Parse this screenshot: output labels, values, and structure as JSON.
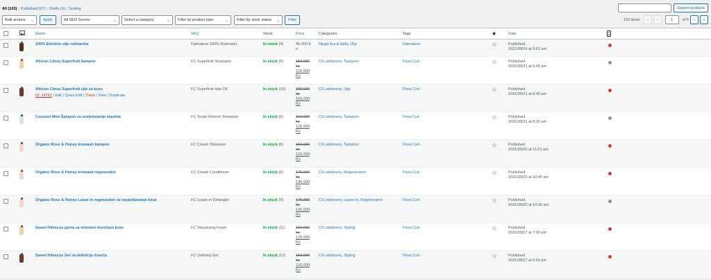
{
  "views": {
    "all": "All (103)",
    "published": "Published (97)",
    "drafts": "Drafts (6)",
    "sorting": "Sorting"
  },
  "search": {
    "button": "Search products"
  },
  "filters": {
    "bulk_actions": "Bulk actions",
    "apply": "Apply",
    "seo_scores": "All SEO Scores",
    "category": "Select a category",
    "product_type": "Filter by product type",
    "stock_status": "Filter by stock status",
    "filter": "Filter"
  },
  "pagination": {
    "items": "103 items",
    "first": "«",
    "prev": "‹",
    "page": "1",
    "of": "of 5",
    "next": "›",
    "last": "»"
  },
  "columns": {
    "name": "Name",
    "sku": "SKU",
    "stock": "Stock",
    "price": "Price",
    "categories": "Categories",
    "tags": "Tags",
    "date": "Date"
  },
  "row_actions": {
    "id": "ID: 14761",
    "edit": "Edit",
    "quick_edit": "Quick Edit",
    "trash": "Trash",
    "view": "View",
    "duplicate": "Duplicate"
  },
  "rows": [
    {
      "name": "100% Eterično ulje ružmarina",
      "sku": "Dalmature 100% Ružmarin",
      "stock": "In stock",
      "qty": "(4)",
      "price_old": "",
      "price": [
        "45,000 K",
        "n"
      ],
      "categories": "Njega lica & tijela, Ulja",
      "tags": "Dalmature",
      "status": "Published",
      "date": "2021/09/24 at 9:52 am",
      "dot": "#d63638",
      "thumb": "#5a2c1c"
    },
    {
      "name": "African Citrus Superfruit šampon",
      "sku": "FC Superfruit Shampoo",
      "stock": "In stock",
      "qty": "(5)",
      "price_old": [
        "150,000",
        "kn"
      ],
      "price": [
        "120,000",
        "Kn"
      ],
      "categories": "CG odobreno, Šamponi",
      "tags": "Flora Curl",
      "status": "Published",
      "date": "2021/09/21 at 5:09 am",
      "dot": "#8c8f94",
      "thumb": "#e8d6a6"
    },
    {
      "name": "African Citrus Superfruit ulje za kosu",
      "sku": "FC Superfruit Hair Oil",
      "stock": "In stock",
      "qty": "(10)",
      "price_old": [
        "200,000",
        "kn"
      ],
      "price": [
        "160,000",
        "Kn"
      ],
      "categories": "CG odobreno, Ulja",
      "tags": "Flora Curl",
      "status": "Published",
      "date": "2021/09/21 at 8:40 am",
      "dot": "#d63638",
      "thumb": "#6a3b2a"
    },
    {
      "name": "Coconut Mint Šampon za osvježavanje vlasišta",
      "sku": "FC Scalp Refresh Shampoo",
      "stock": "In stock",
      "qty": "(6)",
      "price_old": [
        "160,000",
        "kn"
      ],
      "price": [
        "128,000",
        "Kn"
      ],
      "categories": "CG odobreno, Šamponi",
      "tags": "Flora Curl",
      "status": "Published",
      "date": "2021/09/21 at 8:20 am",
      "dot": "#8c8f94",
      "thumb": "#cfe6ea"
    },
    {
      "name": "Organic Rose & Honey kremasti šampon",
      "sku": "FC Cream Shampoo",
      "stock": "In stock",
      "qty": "(8)",
      "price_old": [
        "150,000",
        "kn"
      ],
      "price": [
        "120,000",
        "Kn"
      ],
      "categories": "CG odobreno, Šamponi",
      "tags": "Flora Curl",
      "status": "Published",
      "date": "2021/09/20 at 11:01 am",
      "dot": "#d63638",
      "thumb": "#f1d7cf"
    },
    {
      "name": "Organic Rose & Honey kremasti regenerator",
      "sku": "FC Cream Conditioner",
      "stock": "In stock",
      "qty": "(6)",
      "price_old": [
        "175,000",
        "kn"
      ],
      "price": [
        "140,000",
        "Kn"
      ],
      "categories": "CG odobreno, Regeneratori",
      "tags": "Flora Curl",
      "status": "Published",
      "date": "2021/09/20 at 10:45 am",
      "dot": "#d63638",
      "thumb": "#f1d7cf"
    },
    {
      "name": "Organic Rose & Honey Leave in regenerator za raspetljavanje kose",
      "sku": "FC Leave-in Detangler",
      "stock": "In stock",
      "qty": "(9)",
      "price_old": [
        "175,000",
        "kn"
      ],
      "price": [
        "140,000",
        "Kn"
      ],
      "categories": "CG odobreno, Leave-in, Regeneratori",
      "tags": "Flora Curl",
      "status": "Published",
      "date": "2021/09/20 at 10:30 am",
      "dot": "#8c8f94",
      "thumb": "#f1d7cf"
    },
    {
      "name": "Sweet Hibiscus pjena za volumen kovrčave kose",
      "sku": "FC Volumizing Foam",
      "stock": "In stock",
      "qty": "(11)",
      "price_old": [
        "160,000",
        "kn"
      ],
      "price": [
        "128,000",
        "Kn"
      ],
      "categories": "CG odobreno, Styling",
      "tags": "Flora Curl",
      "status": "Published",
      "date": "2021/09/17 at 7:06 pm",
      "dot": "#d63638",
      "thumb": "#e9d3a3"
    },
    {
      "name": "Sweet Hibiscus Gel za definiciju kovrča",
      "sku": "FC Defining Gel",
      "stock": "In stock",
      "qty": "(12)",
      "price_old": [
        "150,000",
        "kn"
      ],
      "price": [
        "120,000",
        "Kn"
      ],
      "categories": "CG odobreno, Styling",
      "tags": "Flora Curl",
      "status": "Published",
      "date": "2021/09/17 at 6:50 pm",
      "dot": "#d63638",
      "thumb": "#6a3b2a"
    }
  ]
}
